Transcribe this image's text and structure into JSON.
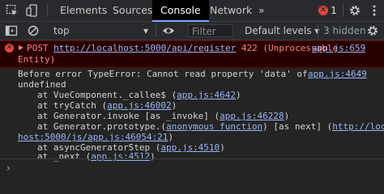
{
  "tabs": {
    "elements": "Elements",
    "sources": "Sources",
    "console": "Console",
    "network": "Network",
    "more": "»"
  },
  "status": {
    "error_count": "1"
  },
  "toolbar": {
    "context": "top",
    "filter_placeholder": "Filter",
    "levels": "Default levels ▾",
    "hidden": "3 hidden"
  },
  "error": {
    "prefix": "POST ",
    "url": "http://localhost:5000/api/register",
    "suffix": " 422 (Unprocessable",
    "line2": "Entity)",
    "source": "app.js:659"
  },
  "trace": {
    "line1": "Before error TypeError: Cannot read property 'data' of",
    "line1_source": "app.js:4649",
    "line2": "undefined",
    "frames": [
      {
        "pre": "at VueComponent._callee$ (",
        "link": "app.js:4642",
        "post": ")"
      },
      {
        "pre": "at tryCatch (",
        "link": "app.js:46002",
        "post": ")"
      },
      {
        "pre": "at Generator.invoke [as _invoke] (",
        "link": "app.js:46228",
        "post": ")"
      },
      {
        "pre": "at Generator.prototype.(",
        "link": "anonymous function",
        "post": ") [as next] (",
        "link2": "http://local"
      },
      {
        "pre": "",
        "link": "host:5000/js/app.js:46054:21",
        "post": ")"
      },
      {
        "pre": "at asyncGeneratorStep (",
        "link": "app.js:4510",
        "post": ")"
      },
      {
        "pre": "at _next (",
        "link": "app.js:4512",
        "post": ")"
      }
    ]
  },
  "prompt": "›",
  "colors": {
    "error_bg": "#290000",
    "error_text": "#ff8080",
    "link": "#9ab5f5",
    "accent": "#7cacf8"
  }
}
